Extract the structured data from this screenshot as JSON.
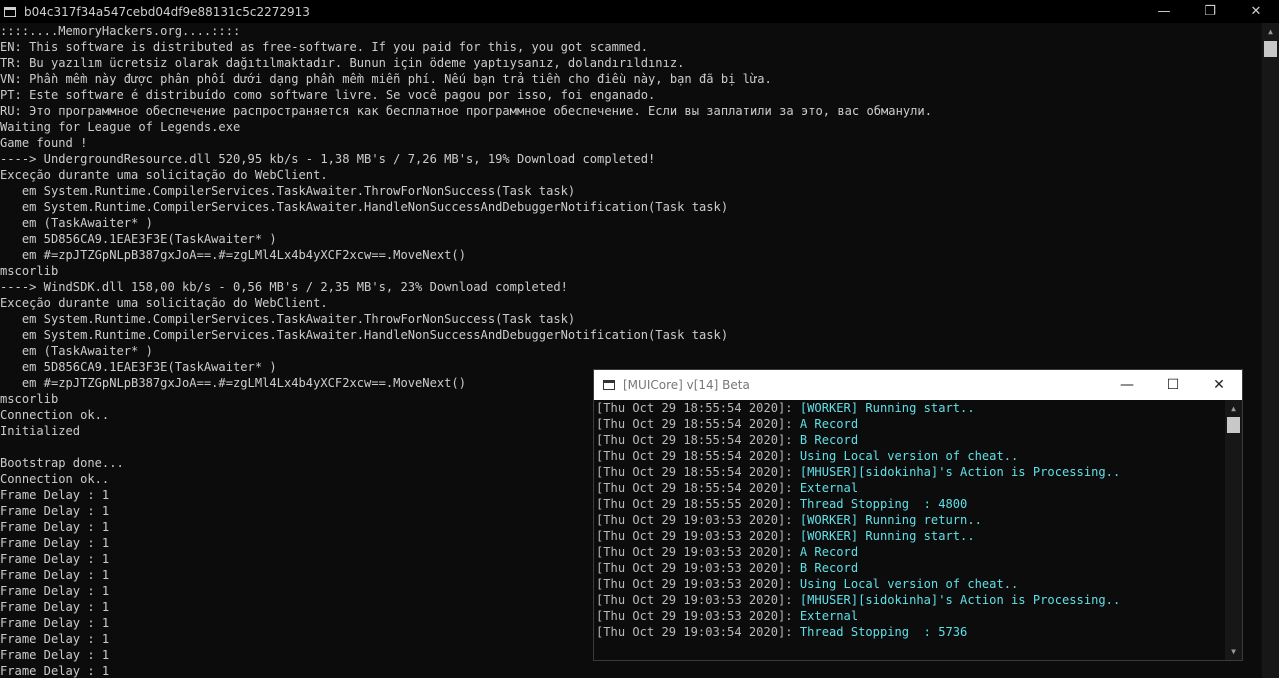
{
  "main_window": {
    "title": "b04c317f34a547cebd04df9e88131c5c2272913",
    "minimize": "—",
    "maximize": "❐",
    "close": "✕"
  },
  "console": {
    "lines": [
      "::::....MemoryHackers.org....::::",
      "EN: This software is distributed as free-software. If you paid for this, you got scammed.",
      "TR: Bu yazılım ücretsiz olarak dağıtılmaktadır. Bunun için ödeme yaptıysanız, dolandırıldınız.",
      "VN: Phần mềm này được phân phối dưới dạng phần mềm miễn phí. Nếu bạn trả tiền cho điều này, bạn đã bị lừa.",
      "PT: Este software é distribuído como software livre. Se você pagou por isso, foi enganado.",
      "RU: Это программное обеспечение распространяется как бесплатное программное обеспечение. Если вы заплатили за это, вас обманули.",
      "Waiting for League of Legends.exe",
      "Game found !",
      "----> UndergroundResource.dll 520,95 kb/s - 1,38 MB's / 7,26 MB's, 19% Download completed!",
      "Exceção durante uma solicitação do WebClient.",
      "   em System.Runtime.CompilerServices.TaskAwaiter.ThrowForNonSuccess(Task task)",
      "   em System.Runtime.CompilerServices.TaskAwaiter.HandleNonSuccessAndDebuggerNotification(Task task)",
      "   em (TaskAwaiter* )",
      "   em 5D856CA9.1EAE3F3E(TaskAwaiter* )",
      "   em #=zpJTZGpNLpB387gxJoA==.#=zgLMl4Lx4b4yXCF2xcw==.MoveNext()",
      "mscorlib",
      "----> WindSDK.dll 158,00 kb/s - 0,56 MB's / 2,35 MB's, 23% Download completed!",
      "Exceção durante uma solicitação do WebClient.",
      "   em System.Runtime.CompilerServices.TaskAwaiter.ThrowForNonSuccess(Task task)",
      "   em System.Runtime.CompilerServices.TaskAwaiter.HandleNonSuccessAndDebuggerNotification(Task task)",
      "   em (TaskAwaiter* )",
      "   em 5D856CA9.1EAE3F3E(TaskAwaiter* )",
      "   em #=zpJTZGpNLpB387gxJoA==.#=zgLMl4Lx4b4yXCF2xcw==.MoveNext()",
      "mscorlib",
      "Connection ok..",
      "Initialized",
      "",
      "Bootstrap done...",
      "Connection ok..",
      "Frame Delay : 1",
      "Frame Delay : 1",
      "Frame Delay : 1",
      "Frame Delay : 1",
      "Frame Delay : 1",
      "Frame Delay : 1",
      "Frame Delay : 1",
      "Frame Delay : 1",
      "Frame Delay : 1",
      "Frame Delay : 1",
      "Frame Delay : 1",
      "Frame Delay : 1"
    ]
  },
  "mui_window": {
    "title": "[MUICore] v[14] Beta",
    "minimize": "—",
    "maximize": "☐",
    "close": "✕",
    "log": [
      {
        "ts": "[Thu Oct 29 18:55:54 2020]: ",
        "msg": "[WORKER] Running start.."
      },
      {
        "ts": "[Thu Oct 29 18:55:54 2020]: ",
        "msg": "A Record"
      },
      {
        "ts": "[Thu Oct 29 18:55:54 2020]: ",
        "msg": "B Record"
      },
      {
        "ts": "[Thu Oct 29 18:55:54 2020]: ",
        "msg": "Using Local version of cheat.."
      },
      {
        "ts": "[Thu Oct 29 18:55:54 2020]: ",
        "msg": "[MHUSER][sidokinha]'s Action is Processing.."
      },
      {
        "ts": "[Thu Oct 29 18:55:54 2020]: ",
        "msg": "External"
      },
      {
        "ts": "[Thu Oct 29 18:55:55 2020]: ",
        "msg": "Thread Stopping  : 4800"
      },
      {
        "ts": "[Thu Oct 29 19:03:53 2020]: ",
        "msg": "[WORKER] Running return.."
      },
      {
        "ts": "[Thu Oct 29 19:03:53 2020]: ",
        "msg": "[WORKER] Running start.."
      },
      {
        "ts": "[Thu Oct 29 19:03:53 2020]: ",
        "msg": "A Record"
      },
      {
        "ts": "[Thu Oct 29 19:03:53 2020]: ",
        "msg": "B Record"
      },
      {
        "ts": "[Thu Oct 29 19:03:53 2020]: ",
        "msg": "Using Local version of cheat.."
      },
      {
        "ts": "[Thu Oct 29 19:03:53 2020]: ",
        "msg": "[MHUSER][sidokinha]'s Action is Processing.."
      },
      {
        "ts": "[Thu Oct 29 19:03:53 2020]: ",
        "msg": "External"
      },
      {
        "ts": "[Thu Oct 29 19:03:54 2020]: ",
        "msg": "Thread Stopping  : 5736"
      }
    ]
  },
  "scrollbar": {
    "up_arrow": "▲",
    "down_arrow": "▼"
  }
}
